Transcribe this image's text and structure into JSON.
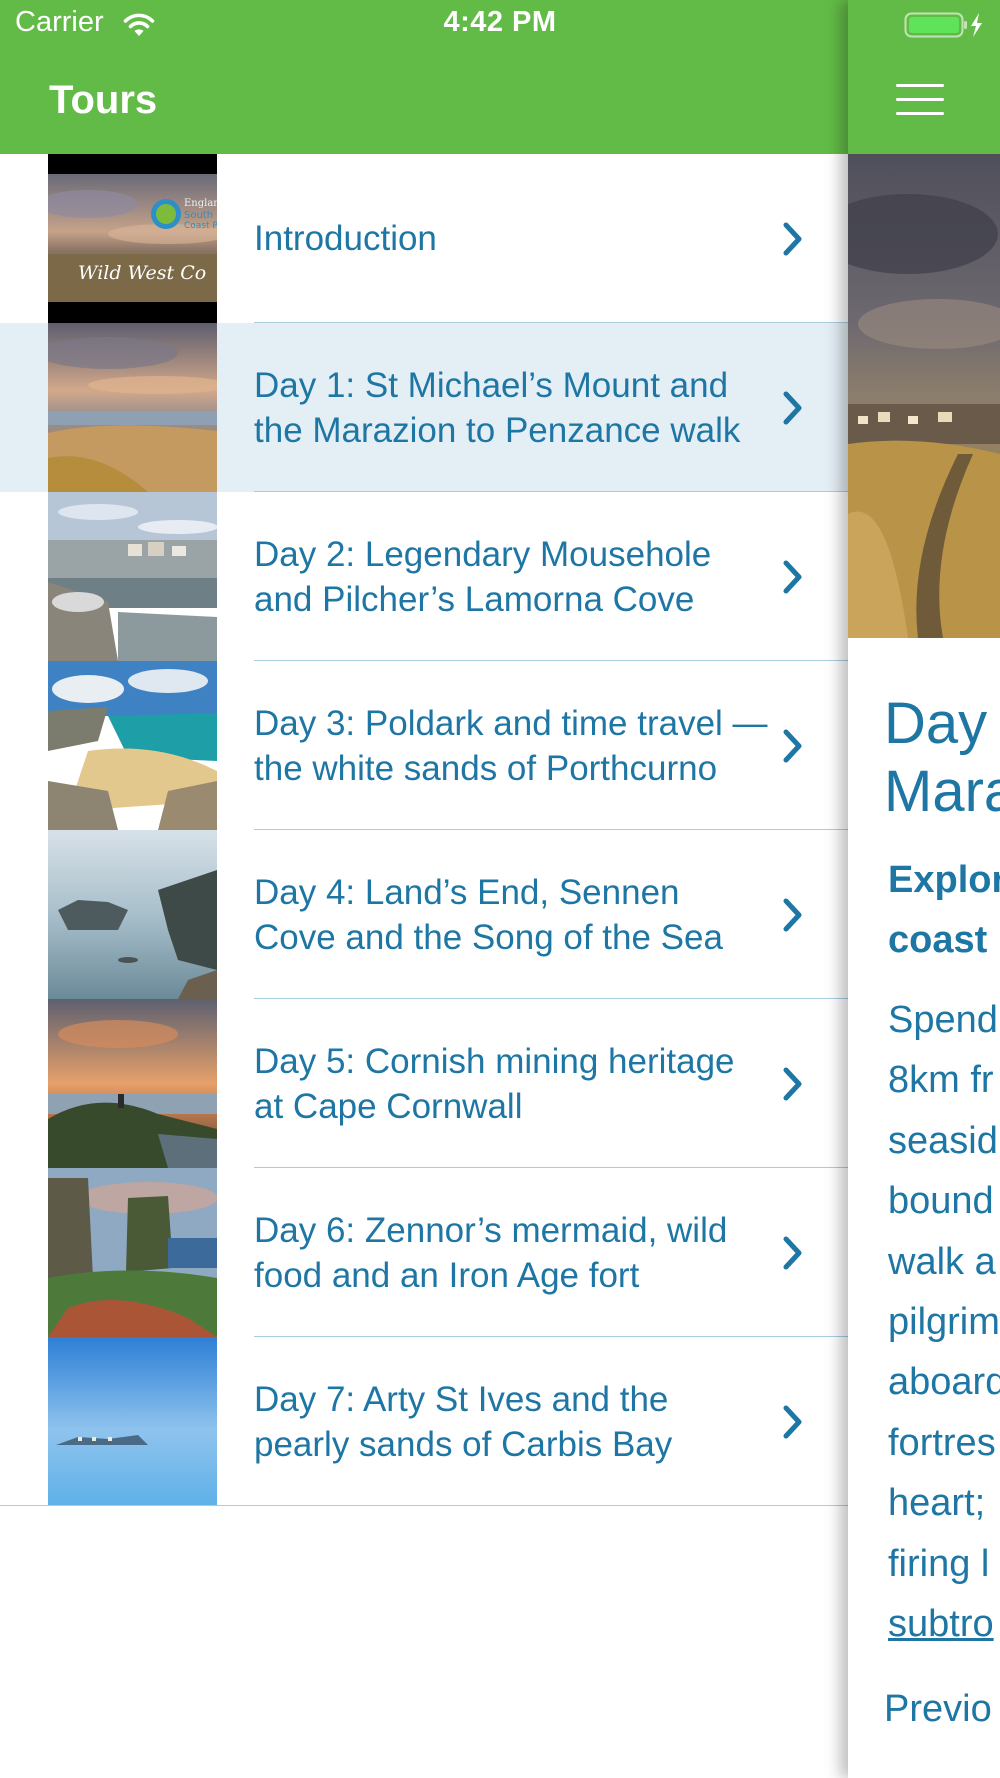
{
  "status_bar": {
    "carrier": "Carrier",
    "time": "4:42 PM"
  },
  "drawer": {
    "title": "Tours",
    "items": [
      {
        "label": "Introduction",
        "selected": false,
        "thumb_overlay": "Wild West Co"
      },
      {
        "label": "Day 1: St Michael’s Mount and the Marazion to Penzance walk",
        "selected": true
      },
      {
        "label": "Day 2: Legendary Mousehole and Pilcher’s Lamorna Cove",
        "selected": false
      },
      {
        "label": "Day 3: Poldark and time travel — the white sands of Porthcurno",
        "selected": false
      },
      {
        "label": "Day 4: Land’s End, Sennen Cove and the Song of the Sea",
        "selected": false
      },
      {
        "label": "Day 5: Cornish mining heritage at Cape Cornwall",
        "selected": false
      },
      {
        "label": "Day 6: Zennor’s mermaid, wild food and an Iron Age fort",
        "selected": false
      },
      {
        "label": "Day 7: Arty St Ives and the pearly sands of Carbis Bay",
        "selected": false
      }
    ]
  },
  "peek": {
    "title_lines": [
      "Day",
      "Mara"
    ],
    "subtitle_lines": [
      "Explor",
      "coast"
    ],
    "body_lines": [
      "Spend",
      "8km fr",
      "seasid",
      "bound",
      "walk a",
      "pilgrim",
      "aboard",
      "fortres",
      "heart;",
      "firing l"
    ],
    "link_text": "subtro",
    "previous_label": "Previo"
  },
  "colors": {
    "nav_green": "#63bb47",
    "text_blue": "#1e76a4",
    "selected_row": "#e4eef5",
    "divider": "#a9cde0"
  },
  "icons": {
    "chevron": "chevron-right-icon",
    "menu": "hamburger-menu-icon",
    "wifi": "wifi-icon",
    "battery": "battery-charging-icon"
  }
}
